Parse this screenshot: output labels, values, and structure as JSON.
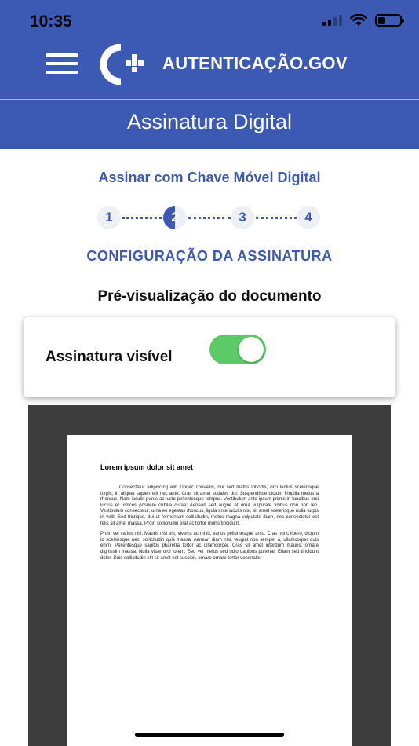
{
  "status_bar": {
    "time": "10:35"
  },
  "header": {
    "brand": "AUTENTICAÇÃO.GOV",
    "page_title": "Assinatura Digital",
    "background_color": "#3c59b3"
  },
  "icons": {
    "menu": "hamburger-icon",
    "logo": "autenticacao-gov-logo",
    "signal": "cellular-signal-icon",
    "wifi": "wifi-icon",
    "battery": "battery-icon"
  },
  "signing": {
    "subtitle": "Assinar com Chave Móvel Digital",
    "steps": [
      "1",
      "2",
      "3",
      "4"
    ],
    "current_step": 2,
    "section_title": "CONFIGURAÇÃO DA ASSINATURA",
    "preview_title": "Pré-visualização do documento"
  },
  "visible_signature": {
    "label": "Assinatura visível",
    "enabled": true,
    "on_color": "#5ccb67"
  },
  "document": {
    "heading": "Lorem ipsum dolor sit amet",
    "paragraphs": [
      "Consectetur adipiscing elit. Donec convallis, dui sed mattis lobortis, orci lectus scelerisque turpis, in aliquet sapien elit nec ante. Cras sit amet sodales dui. Suspendisse dictum fringilla metus a rhoncus. Nam iaculis purus ac justo pellentesque tempus. Vestibulum ante ipsum primis in faucibus orci luctus et ultrices posuere cubilia curae; Aenean sed augue et urna vulputate finibus non non leo. Vestibulum consectetur, urna eu egestas rhoncus, ligula ante iaculis nisi, sit amet scelerisque nulla turpis in velit. Sed tristique, dui ut fermentum sollicitudin, metus magna vulputate diam, nec consectetur est felis sit amet massa. Proin sollicitudin erat ac tortor mollis tincidunt.",
      "Proin vel varius nisl. Mauris nisl est, viverra ac mi id, varius pellentesque arcu. Cras nunc libero, dictum id scelerisque nec, sollicitudin quis massa. Aenean diam nisi, feugiat non semper a, ullamcorper quis enim. Pellentesque sagittis pharetra tortor ac ullamcorper. Cras sit amet interdum mauris, ornare dignissim massa. Nulla vitae orci lorem. Sed vel metus sed odio dapibus pulvinar. Etiam sed tincidunt dolor. Duis sollicitudin elit sit amet est suscipit, ornare ornare tortor venenatis."
    ]
  }
}
